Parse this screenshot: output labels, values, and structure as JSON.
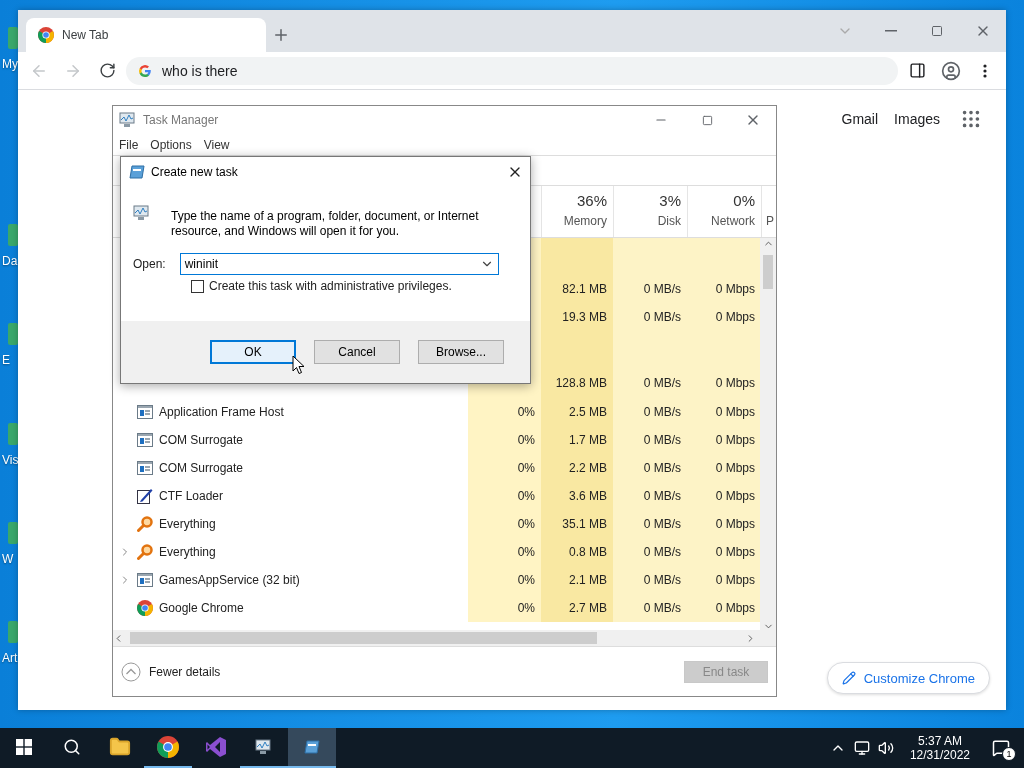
{
  "desktop": {
    "icons": [
      {
        "label": "My"
      },
      {
        "label": "Da"
      },
      {
        "label": "E"
      },
      {
        "label": "Vis"
      },
      {
        "label": "W"
      },
      {
        "label": "Art"
      }
    ]
  },
  "browser": {
    "tabs": [
      {
        "title": "New Tab",
        "selected": true
      }
    ],
    "back_disabled": true,
    "forward_disabled": true,
    "omnibox": {
      "value": "who is there"
    },
    "links": [
      "Gmail",
      "Images"
    ],
    "customize_button": "Customize Chrome"
  },
  "task_manager": {
    "title": "Task Manager",
    "menu": [
      "File",
      "Options",
      "View"
    ],
    "columns": [
      {
        "percent": "36%",
        "label": "Memory"
      },
      {
        "percent": "3%",
        "label": "Disk"
      },
      {
        "percent": "0%",
        "label": "Network"
      },
      {
        "label": "P"
      }
    ],
    "rows": [
      {
        "kind": "group"
      },
      {
        "kind": "partial",
        "memory": "82.1 MB",
        "disk": "0 MB/s",
        "network": "0 Mbps"
      },
      {
        "kind": "partial",
        "memory": "19.3 MB",
        "disk": "0 MB/s",
        "network": "0 Mbps"
      },
      {
        "kind": "group"
      },
      {
        "kind": "partial",
        "memory": "128.8 MB",
        "disk": "0 MB/s",
        "network": "0 Mbps"
      },
      {
        "kind": "window",
        "expandable": false,
        "name": "Application Frame Host",
        "cpu": "0%",
        "memory": "2.5 MB",
        "disk": "0 MB/s",
        "network": "0 Mbps"
      },
      {
        "kind": "window",
        "expandable": false,
        "name": "COM Surrogate",
        "cpu": "0%",
        "memory": "1.7 MB",
        "disk": "0 MB/s",
        "network": "0 Mbps"
      },
      {
        "kind": "window",
        "expandable": false,
        "name": "COM Surrogate",
        "cpu": "0%",
        "memory": "2.2 MB",
        "disk": "0 MB/s",
        "network": "0 Mbps"
      },
      {
        "kind": "pen",
        "expandable": false,
        "name": "CTF Loader",
        "cpu": "0%",
        "memory": "3.6 MB",
        "disk": "0 MB/s",
        "network": "0 Mbps"
      },
      {
        "kind": "magnifier",
        "expandable": false,
        "name": "Everything",
        "cpu": "0%",
        "memory": "35.1 MB",
        "disk": "0 MB/s",
        "network": "0 Mbps"
      },
      {
        "kind": "magnifier",
        "expandable": true,
        "name": "Everything",
        "cpu": "0%",
        "memory": "0.8 MB",
        "disk": "0 MB/s",
        "network": "0 Mbps"
      },
      {
        "kind": "window",
        "expandable": true,
        "name": "GamesAppService (32 bit)",
        "cpu": "0%",
        "memory": "2.1 MB",
        "disk": "0 MB/s",
        "network": "0 Mbps"
      },
      {
        "kind": "chrome",
        "expandable": false,
        "name": "Google Chrome",
        "cpu": "0%",
        "memory": "2.7 MB",
        "disk": "0 MB/s",
        "network": "0 Mbps"
      }
    ],
    "fewer_details": "Fewer details",
    "end_task": {
      "label": "End task",
      "disabled": true
    }
  },
  "dialog": {
    "title": "Create new task",
    "description": "Type the name of a program, folder, document, or Internet resource, and Windows will open it for you.",
    "open_label": "Open:",
    "open_value": "wininit",
    "checkbox": {
      "label": "Create this task with administrative privileges.",
      "checked": false
    },
    "buttons": [
      {
        "label": "OK",
        "focused": true
      },
      {
        "label": "Cancel",
        "focused": false
      },
      {
        "label": "Browse...",
        "focused": false
      }
    ]
  },
  "taskbar": {
    "apps": [
      {
        "kind": "explorer",
        "running": false,
        "active": false
      },
      {
        "kind": "chrome",
        "running": true,
        "active": false
      },
      {
        "kind": "studio",
        "running": false,
        "active": false
      },
      {
        "kind": "taskmgr",
        "running": true,
        "active": false
      },
      {
        "kind": "run",
        "running": true,
        "active": true
      }
    ],
    "time": "5:37 AM",
    "date": "12/31/2022",
    "notifications": "1"
  }
}
